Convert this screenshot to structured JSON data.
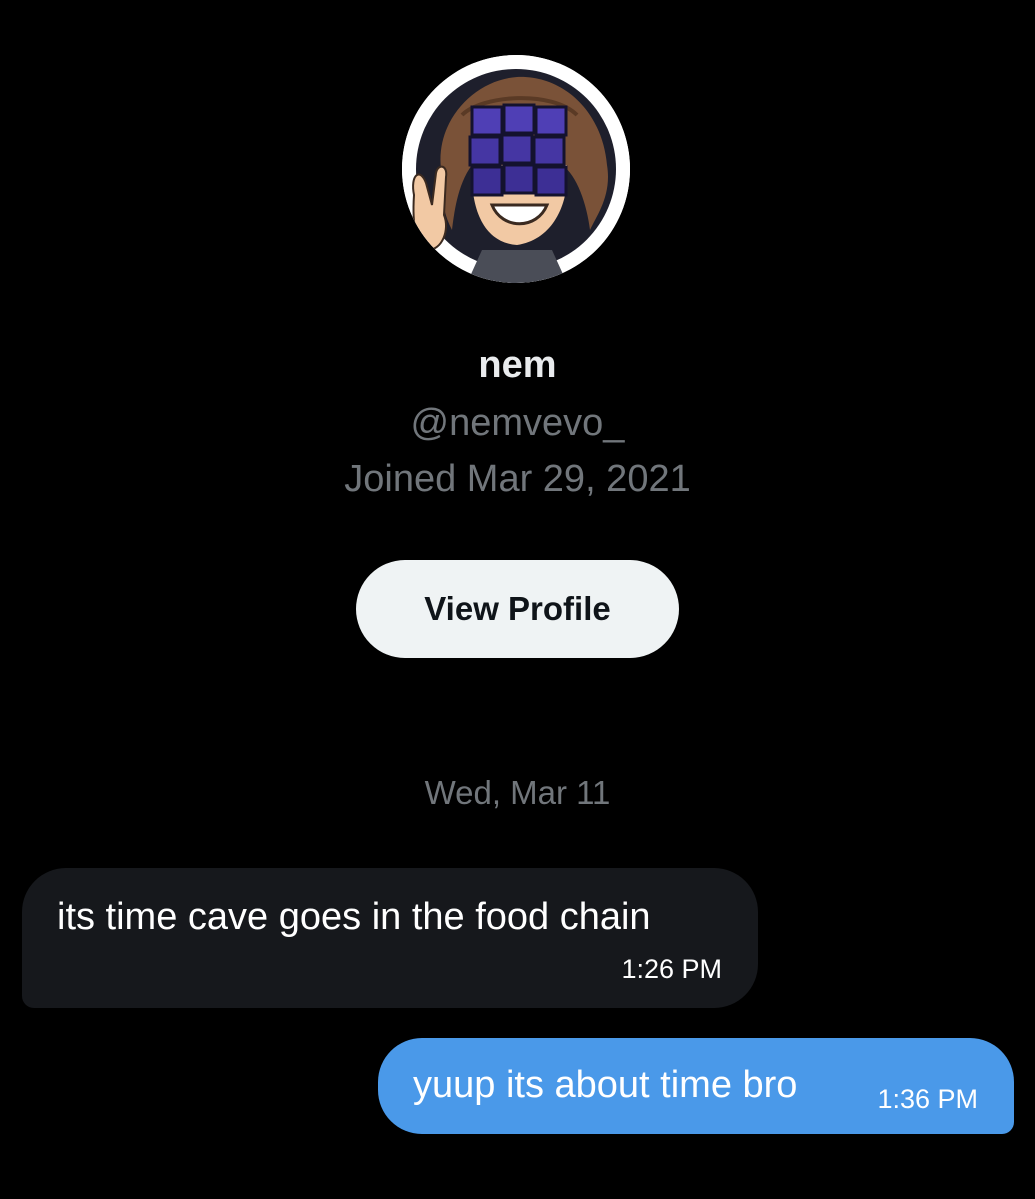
{
  "profile": {
    "avatar_icon": "user-avatar-illustration",
    "display_name": "nem",
    "handle": "@nemvevo_",
    "joined": "Joined Mar 29, 2021",
    "view_profile_label": "View Profile"
  },
  "conversation": {
    "date_separator": "Wed, Mar 11",
    "messages": [
      {
        "direction": "incoming",
        "text": "its time cave goes in the food chain",
        "time": "1:26 PM"
      },
      {
        "direction": "outgoing",
        "text": "yuup its about time bro",
        "time": "1:36 PM"
      }
    ]
  },
  "colors": {
    "background": "#000000",
    "incoming_bubble": "#16181c",
    "outgoing_bubble": "#4a99e9",
    "button_bg": "#eff3f4",
    "muted_text": "#71767b"
  }
}
